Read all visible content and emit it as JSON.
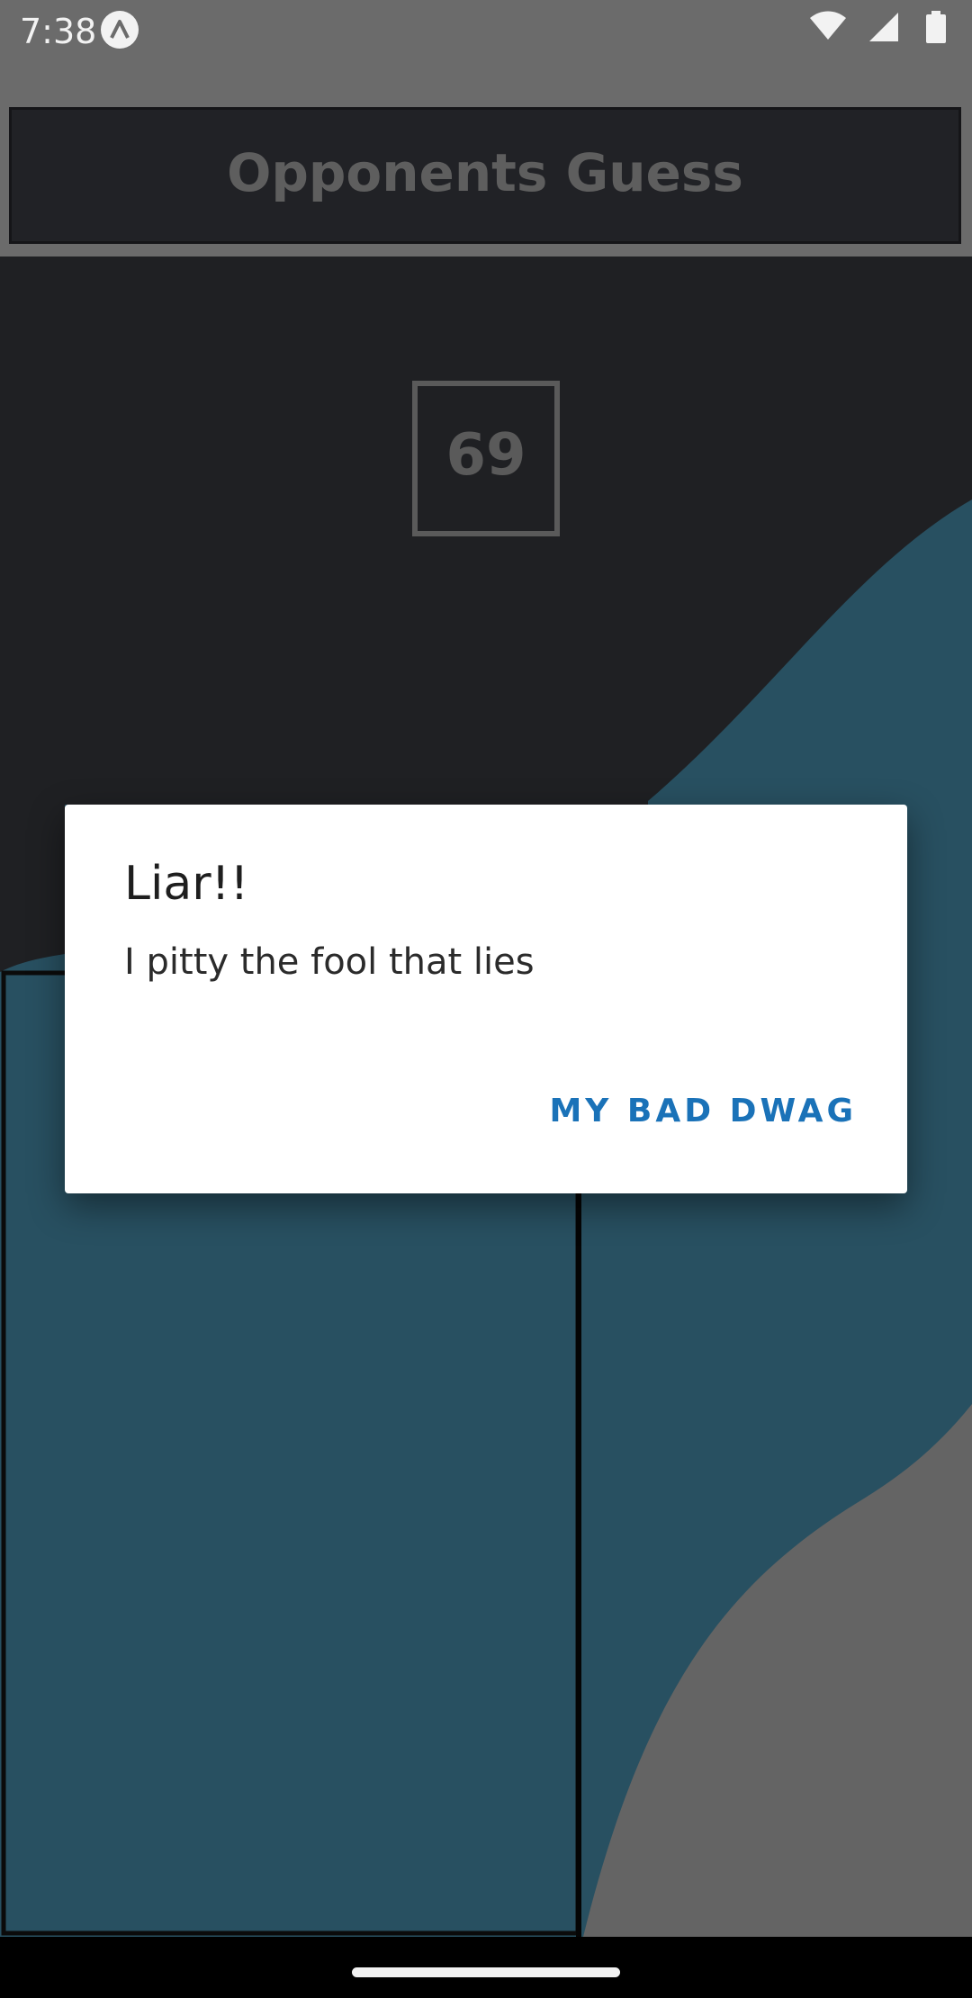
{
  "status_bar": {
    "time": "7:38",
    "icons": [
      "app-notification-icon",
      "wifi-icon",
      "cell-signal-icon",
      "battery-icon"
    ]
  },
  "header": {
    "title": "Opponents Guess"
  },
  "guess": {
    "number": "69"
  },
  "dialog": {
    "title": "Liar!!",
    "message": "I pitty the fool that lies",
    "button_label": "MY BAD DWAG"
  },
  "colors": {
    "background": "#1f2023",
    "wave_teal": "#285061",
    "wave_gray": "#646464",
    "dialog_button": "#1a72b8",
    "header_bg": "#212226",
    "status_bar_bg": "#6b6b6b"
  }
}
